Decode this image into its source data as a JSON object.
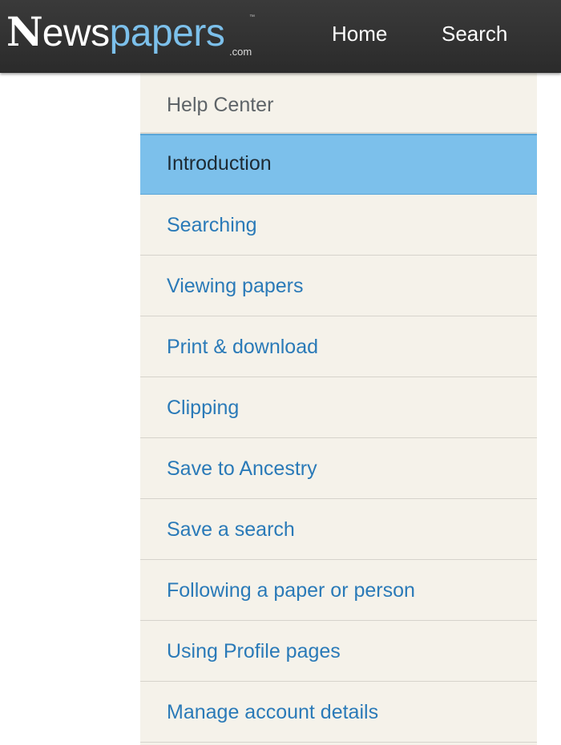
{
  "header": {
    "logo": {
      "first_letter": "N",
      "white_part": "ews",
      "blue_part": "papers",
      "trademark": "™",
      "suffix": ".com"
    },
    "nav": {
      "home": "Home",
      "search": "Search"
    }
  },
  "sidebar": {
    "title": "Help Center",
    "items": [
      {
        "label": "Introduction",
        "active": true
      },
      {
        "label": "Searching"
      },
      {
        "label": "Viewing papers"
      },
      {
        "label": "Print & download"
      },
      {
        "label": "Clipping"
      },
      {
        "label": "Save to Ancestry"
      },
      {
        "label": "Save a search"
      },
      {
        "label": "Following a paper or person"
      },
      {
        "label": "Using Profile pages"
      },
      {
        "label": "Manage account details"
      }
    ]
  },
  "colors": {
    "header_bg": "#2f2f2f",
    "logo_blue": "#7cc0eb",
    "sidebar_bg": "#f5f2ea",
    "link": "#2a7ab8",
    "active_bg": "#7cc0eb"
  }
}
